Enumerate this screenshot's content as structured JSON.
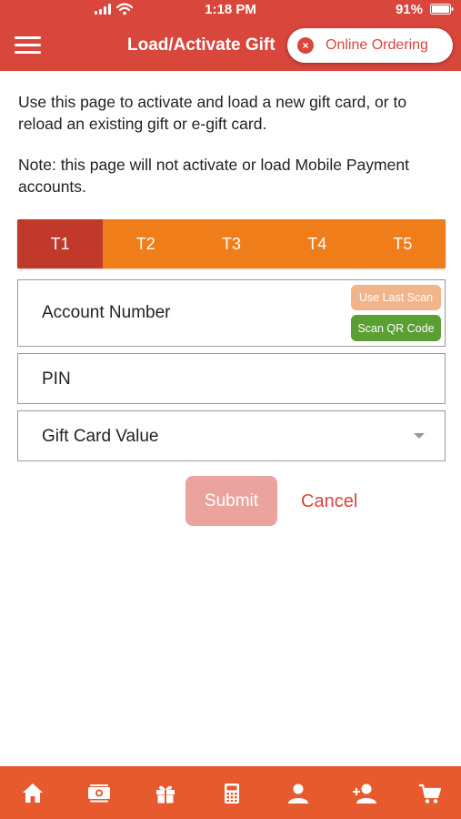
{
  "status_bar": {
    "time": "1:18 PM",
    "battery": "91%"
  },
  "header": {
    "title": "Load/Activate Gift",
    "online_ordering_label": "Online Ordering",
    "close_glyph": "×"
  },
  "content": {
    "intro": "Use this page to activate and load a new gift card, or to reload an existing gift or e-gift card.",
    "note": "Note: this page will not activate or load Mobile Payment accounts."
  },
  "tabs": [
    {
      "label": "T1",
      "active": true
    },
    {
      "label": "T2",
      "active": false
    },
    {
      "label": "T3",
      "active": false
    },
    {
      "label": "T4",
      "active": false
    },
    {
      "label": "T5",
      "active": false
    }
  ],
  "form": {
    "account_number_label": "Account Number",
    "use_last_scan_label": "Use Last Scan",
    "scan_qr_label": "Scan QR Code",
    "pin_label": "PIN",
    "gift_card_value_label": "Gift Card Value"
  },
  "actions": {
    "submit_label": "Submit",
    "cancel_label": "Cancel"
  },
  "bottom_nav": [
    {
      "icon": "home-icon"
    },
    {
      "icon": "money-icon"
    },
    {
      "icon": "gift-icon"
    },
    {
      "icon": "calculator-icon"
    },
    {
      "icon": "user-icon"
    },
    {
      "icon": "add-user-icon"
    },
    {
      "icon": "cart-icon"
    }
  ],
  "colors": {
    "brand_red": "#d9463b",
    "tab_orange": "#ee7d1a",
    "tab_active": "#c0392b",
    "bottom_bar": "#e65a2e",
    "scan_qr_green": "#5a9e34",
    "last_scan_peach": "#f2b48a",
    "submit_disabled": "#eba39d"
  }
}
